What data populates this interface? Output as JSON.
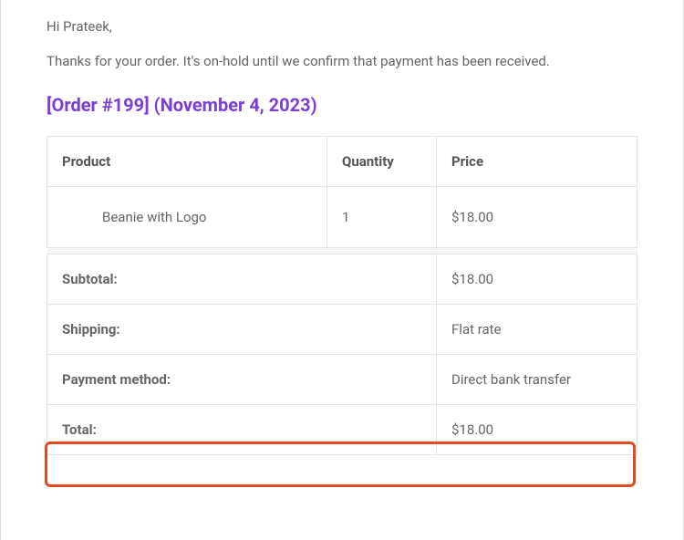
{
  "greeting": "Hi Prateek,",
  "intro": "Thanks for your order. It's on-hold until we confirm that payment has been received.",
  "order_title": "[Order #199] (November 4, 2023)",
  "table": {
    "headers": {
      "product": "Product",
      "quantity": "Quantity",
      "price": "Price"
    },
    "item": {
      "name": "Beanie with Logo",
      "quantity": "1",
      "price": "$18.00"
    },
    "summary": {
      "subtotal_label": "Subtotal:",
      "subtotal_value": "$18.00",
      "shipping_label": "Shipping:",
      "shipping_value": "Flat rate",
      "payment_label": "Payment method:",
      "payment_value": "Direct bank transfer",
      "total_label": "Total:",
      "total_value": "$18.00"
    }
  }
}
